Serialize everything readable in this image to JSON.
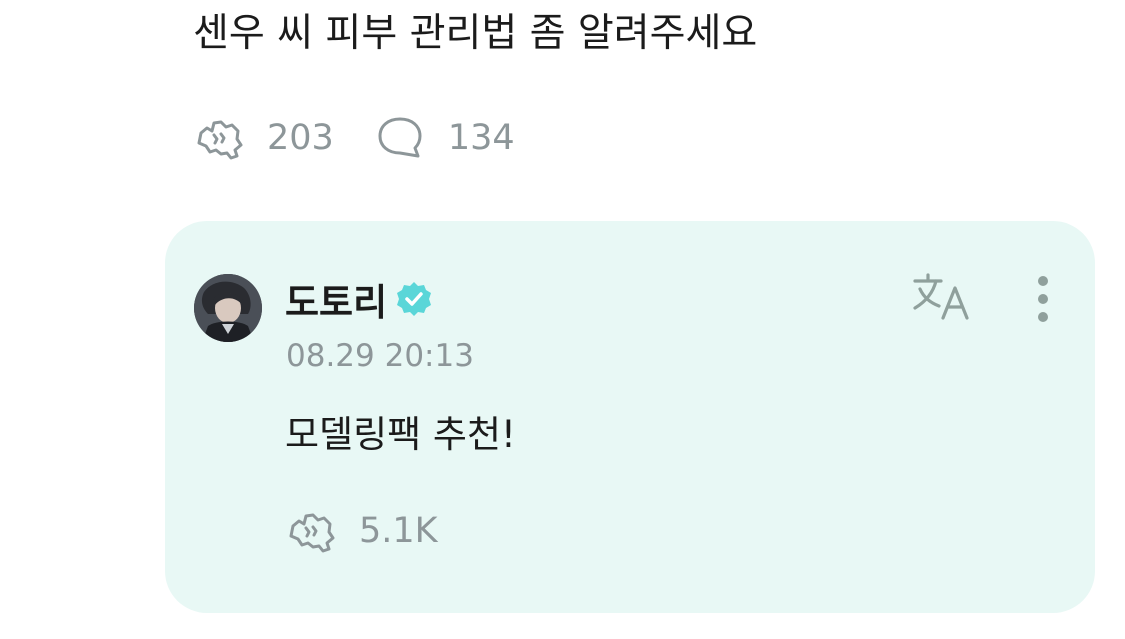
{
  "post": {
    "text": "센우 씨 피부 관리법 좀 알려주세요",
    "like_count": "203",
    "comment_count": "134"
  },
  "comment": {
    "author": "도토리",
    "timestamp": "08.29 20:13",
    "body": "모델링팩 추천!",
    "like_count": "5.1K"
  },
  "icons": {
    "like": "cheer-hands-icon",
    "comment": "speech-bubble-icon",
    "verified": "verified-badge-icon",
    "translate": "translate-icon",
    "more": "more-vertical-icon"
  },
  "colors": {
    "card_background": "#e8f8f5",
    "muted_text": "#8d9699",
    "verified": "#5ad6d8",
    "icon_gray": "#8d9699"
  }
}
